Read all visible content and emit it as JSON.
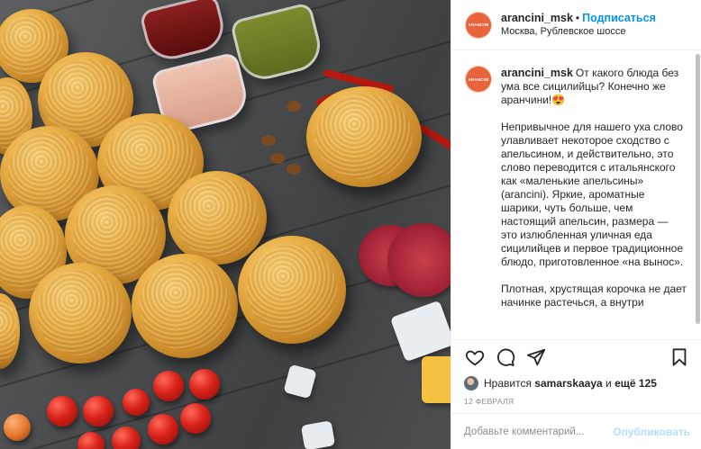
{
  "post": {
    "username": "arancini_msk",
    "separator": "•",
    "follow_label": "Подписаться",
    "location": "Москва, Рублевское шоссе",
    "logo_text": "ARANCINI"
  },
  "caption": {
    "username": "arancini_msk",
    "paragraphs": [
      "От какого блюда без ума все сицилийцы? Конечно же аранчини!😍",
      "Непривычное для нашего уха слово улавливает некоторое сходство с апельсином, и действительно, это слово переводится с итальянского как «маленькие апельсины» (arancini). Яркие, ароматные шарики, чуть больше, чем настоящий апельсин, размера — это излюбленная уличная еда сицилийцев и первое традиционное блюдо, приготовленное «на вынос».",
      "Плотная, хрустящая корочка не дает начинке растечься, а внутри"
    ]
  },
  "actions": {
    "like_icon": "heart-icon",
    "comment_icon": "speech-bubble-icon",
    "share_icon": "paper-plane-icon",
    "save_icon": "bookmark-icon"
  },
  "likes": {
    "prefix": "Нравится",
    "user": "samarskaaya",
    "middle": "и",
    "others": "ещё 125"
  },
  "date": "12 ФЕВРАЛЯ",
  "comment": {
    "placeholder": "Добавьте комментарий...",
    "publish_label": "Опубликовать"
  },
  "colors": {
    "accent": "#0095f6",
    "publish_disabled": "#b2dffc",
    "logo": "#e8643a"
  }
}
